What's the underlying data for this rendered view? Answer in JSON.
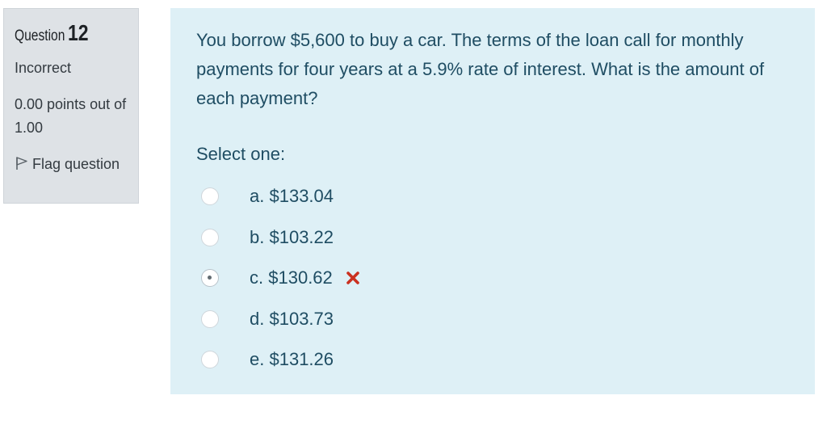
{
  "info": {
    "question_label": "Question",
    "question_number": "12",
    "state": "Incorrect",
    "grade": "0.00 points out of 1.00",
    "flag_label": "Flag question",
    "flag_icon": "flag-outline-icon"
  },
  "question": {
    "text": "You borrow $5,600 to buy a car. The terms of the loan call for monthly payments for four years at a 5.9% rate of interest. What is the amount of each payment?",
    "prompt": "Select one:",
    "answers": [
      {
        "letter": "a.",
        "value": "$133.04",
        "selected": false
      },
      {
        "letter": "b.",
        "value": "$103.22",
        "selected": false
      },
      {
        "letter": "c.",
        "value": "$130.62",
        "selected": true,
        "marked_incorrect": true
      },
      {
        "letter": "d.",
        "value": "$103.73",
        "selected": false
      },
      {
        "letter": "e.",
        "value": "$131.26",
        "selected": false
      }
    ],
    "incorrect_icon": "red-cross-icon"
  },
  "colors": {
    "info_bg": "#dee2e6",
    "content_bg": "#def0f6",
    "text": "#1f4d63",
    "incorrect": "#ca3120"
  }
}
